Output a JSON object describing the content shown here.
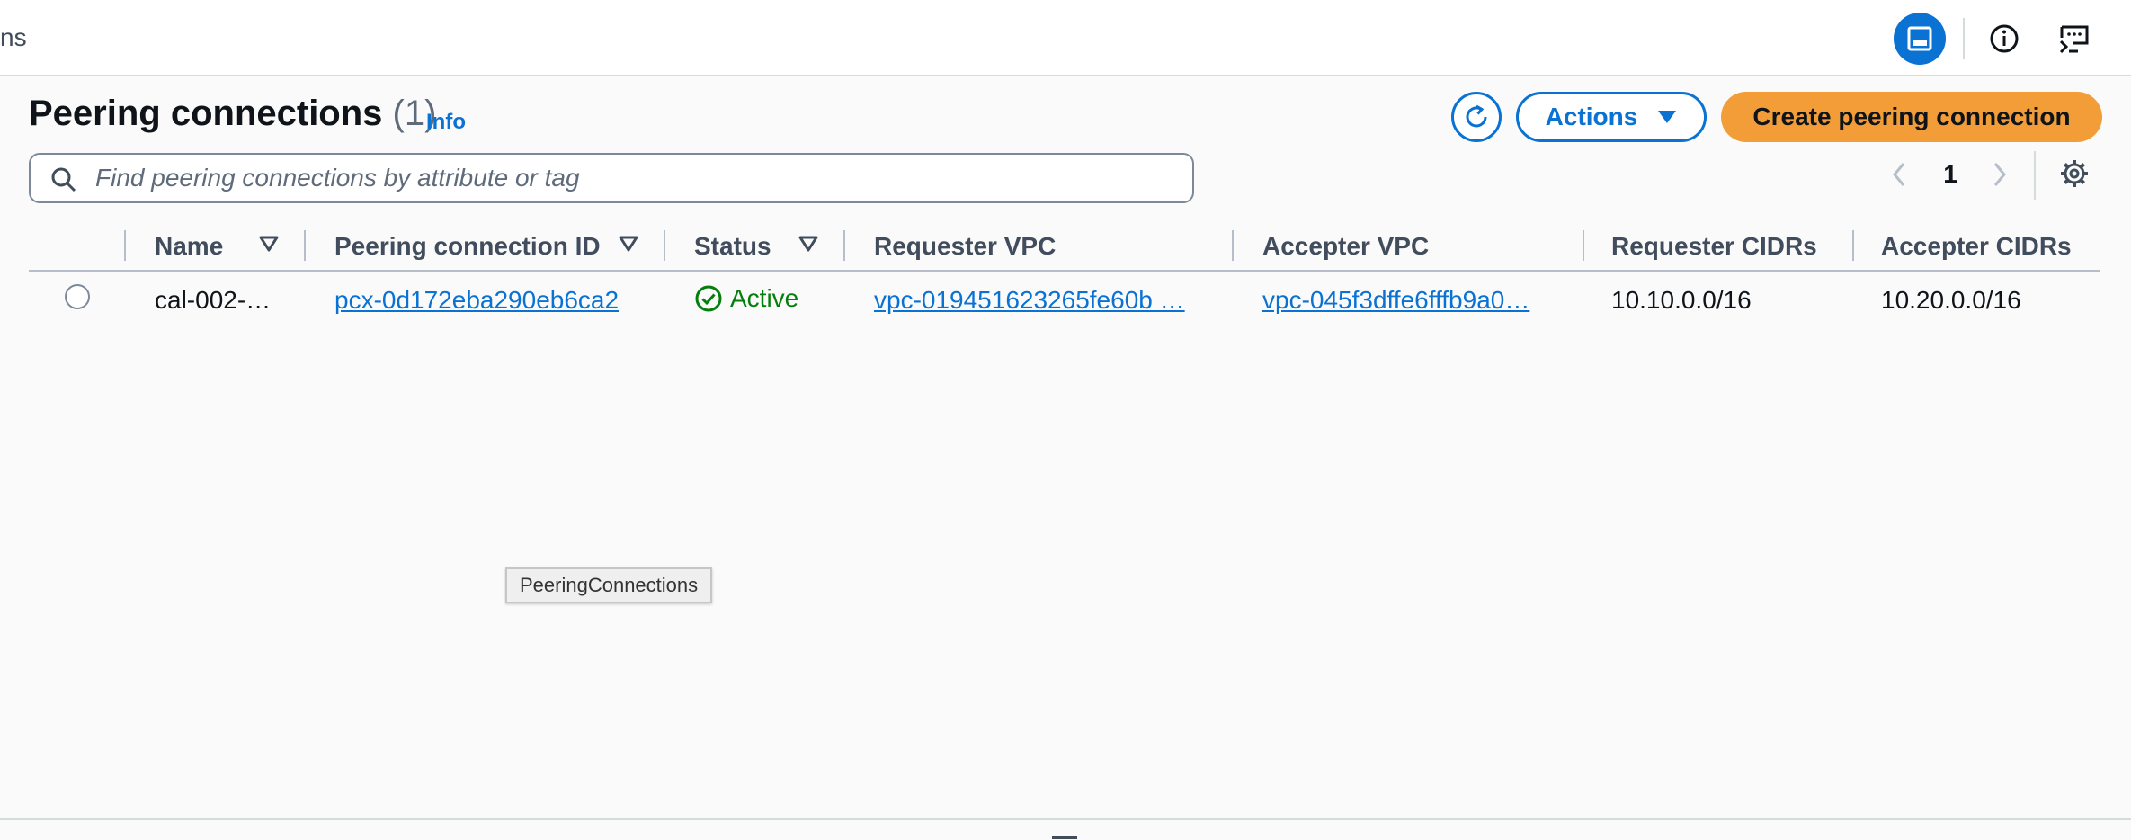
{
  "header": {
    "crumb_fragment": "ns"
  },
  "page": {
    "title": "Peering connections",
    "count": "(1)",
    "info_label": "Info"
  },
  "toolbar": {
    "actions_label": "Actions",
    "create_label": "Create peering connection"
  },
  "search": {
    "placeholder": "Find peering connections by attribute or tag",
    "value": ""
  },
  "pagination": {
    "current_page": "1"
  },
  "table": {
    "columns": [
      "Name",
      "Peering connection ID",
      "Status",
      "Requester VPC",
      "Accepter VPC",
      "Requester CIDRs",
      "Accepter CIDRs"
    ],
    "rows": [
      {
        "name": "cal-002-…",
        "peering_id": "pcx-0d172eba290eb6ca2",
        "status": "Active",
        "requester_vpc": "vpc-019451623265fe60b …",
        "accepter_vpc": "vpc-045f3dffe6fffb9a0…",
        "requester_cidrs": "10.10.0.0/16",
        "accepter_cidrs": "10.20.0.0/16"
      }
    ]
  },
  "tooltip": {
    "text": "PeeringConnections"
  },
  "colors": {
    "link": "#0972d3",
    "primary_button": "#f29d38",
    "status_success": "#037f0c",
    "active_icon_bg": "#0972d3"
  },
  "icons": [
    "split-panel-icon",
    "info-icon",
    "feedback-icon",
    "refresh-icon",
    "caret-down-icon",
    "search-icon",
    "chevron-left-icon",
    "chevron-right-icon",
    "settings-icon",
    "sort-icon",
    "status-success-icon"
  ]
}
